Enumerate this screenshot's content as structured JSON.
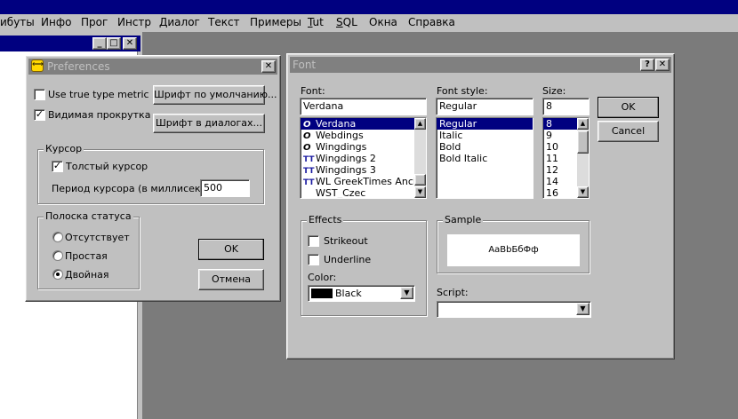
{
  "menu": [
    "ибуты",
    "Инфо",
    "Прог",
    "Инстр",
    "Диалог",
    "Текст",
    "Примеры",
    "Tut",
    "SQL",
    "Окна",
    "Справка"
  ],
  "bg_window": {
    "min": "_",
    "max": "□",
    "close": "✕"
  },
  "prefs": {
    "title": "Preferences",
    "close": "✕",
    "use_true_type": "Use true type metric",
    "visible_scroll": "Видимая прокрутка",
    "default_font_btn": "Шрифт по умолчанию...",
    "dialog_font_btn": "Шрифт в диалогах...",
    "cursor_group": "Курсор",
    "thick_cursor": "Толстый курсор",
    "cursor_period_label": "Период курсора (в миллисек):",
    "cursor_period_value": "500",
    "status_group": "Полоска статуса",
    "status_none": "Отсутствует",
    "status_simple": "Простая",
    "status_double": "Двойная",
    "ok": "OK",
    "cancel": "Отмена"
  },
  "font_dialog": {
    "title": "Font",
    "help": "?",
    "close": "✕",
    "font_label": "Font:",
    "font_value": "Verdana",
    "fonts": [
      {
        "name": "Verdana",
        "icon": "O",
        "type": "otf"
      },
      {
        "name": "Webdings",
        "icon": "O",
        "type": "otf"
      },
      {
        "name": "Wingdings",
        "icon": "O",
        "type": "otf"
      },
      {
        "name": "Wingdings 2",
        "icon": "TT",
        "type": "tt"
      },
      {
        "name": "Wingdings 3",
        "icon": "TT",
        "type": "tt"
      },
      {
        "name": "WL GreekTimes Ancie",
        "icon": "TT",
        "type": "tt"
      },
      {
        "name": "WST_Czec",
        "icon": "",
        "type": "none"
      }
    ],
    "style_label": "Font style:",
    "style_value": "Regular",
    "styles": [
      "Regular",
      "Italic",
      "Bold",
      "Bold Italic"
    ],
    "size_label": "Size:",
    "size_value": "8",
    "sizes": [
      "8",
      "9",
      "10",
      "11",
      "12",
      "14",
      "16"
    ],
    "ok": "OK",
    "cancel": "Cancel",
    "effects_group": "Effects",
    "strikeout": "Strikeout",
    "underline": "Underline",
    "color_label": "Color:",
    "color_value": "Black",
    "sample_group": "Sample",
    "sample_text": "AaBbБбФф",
    "script_label": "Script:",
    "script_value": ""
  }
}
